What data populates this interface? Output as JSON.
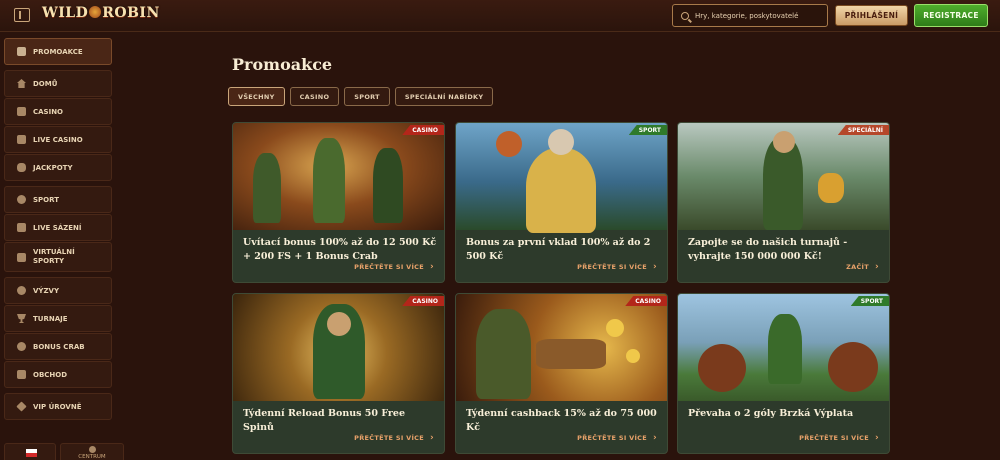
{
  "header": {
    "logo": "WILD ROBIN",
    "search_placeholder": "Hry, kategorie, poskytovatelé",
    "login_label": "PŘIHLÁŠENÍ",
    "register_label": "REGISTRACE"
  },
  "sidebar": {
    "items": [
      {
        "label": "PROMOAKCE",
        "icon": "gift-icon"
      },
      {
        "label": "DOMŮ",
        "icon": "home-icon"
      },
      {
        "label": "CASINO",
        "icon": "slot-icon"
      },
      {
        "label": "LIVE CASINO",
        "icon": "cards-icon"
      },
      {
        "label": "JACKPOTY",
        "icon": "clover-icon"
      },
      {
        "label": "SPORT",
        "icon": "ball-icon"
      },
      {
        "label": "LIVE SÁZENÍ",
        "icon": "live-icon"
      },
      {
        "label": "VIRTUÁLNÍ SPORTY",
        "icon": "virtual-icon"
      },
      {
        "label": "VÝZVY",
        "icon": "target-icon"
      },
      {
        "label": "TURNAJE",
        "icon": "trophy-icon"
      },
      {
        "label": "BONUS CRAB",
        "icon": "crab-icon"
      },
      {
        "label": "OBCHOD",
        "icon": "shop-icon"
      },
      {
        "label": "VIP ÚROVNĚ",
        "icon": "diamond-icon"
      }
    ],
    "help_label": "CENTRUM"
  },
  "main": {
    "title": "Promoakce",
    "filters": [
      "VŠECHNY",
      "CASINO",
      "SPORT",
      "SPECIÁLNÍ NABÍDKY"
    ],
    "cards": [
      {
        "badge": "CASINO",
        "title": "Uvítací bonus 100% až do 12 500 Kč + 200 FS + 1 Bonus Crab",
        "cta": "PŘEČTĚTE SI VÍCE"
      },
      {
        "badge": "SPORT",
        "title": "Bonus za první vklad 100% až do 2 500 Kč",
        "cta": "PŘEČTĚTE SI VÍCE"
      },
      {
        "badge": "SPECIÁLNÍ",
        "title": "Zapojte se do našich turnajů - vyhrajte 150 000 000 Kč!",
        "cta": "ZAČÍT"
      },
      {
        "badge": "CASINO",
        "title": "Týdenní Reload Bonus 50 Free Spinů",
        "cta": "PŘEČTĚTE SI VÍCE"
      },
      {
        "badge": "CASINO",
        "title": "Týdenní cashback 15% až do 75 000 Kč",
        "cta": "PŘEČTĚTE SI VÍCE"
      },
      {
        "badge": "SPORT",
        "title": "Převaha o 2 góly Brzká Výplata",
        "cta": "PŘEČTĚTE SI VÍCE"
      }
    ]
  },
  "colors": {
    "casino_badge": "#b3261a",
    "sport_badge": "#2f7a2a",
    "special_badge": "#b5472a",
    "register_green": "#3f9a24",
    "cta": "#e8a26a"
  }
}
